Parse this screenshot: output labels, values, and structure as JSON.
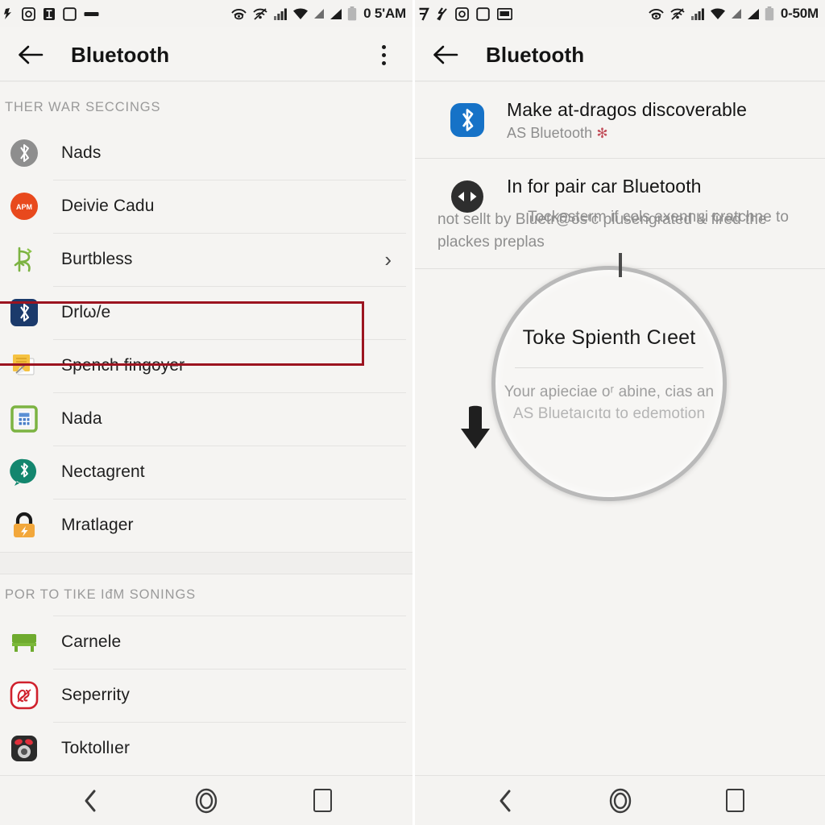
{
  "left_panel": {
    "status_bar": {
      "time": "0 5'AM",
      "left_icons": [
        "notification-icon",
        "screenshot-icon",
        "text-cursor-icon",
        "square-icon",
        "dash-icon"
      ],
      "right_icons": [
        "eye-wifi-icon",
        "cast-icon",
        "signal-bars-icon",
        "wifi-icon",
        "signal-triangle-icon",
        "signal-triangle-2-icon",
        "battery-icon"
      ]
    },
    "action_bar": {
      "title": "Bluetooth",
      "back_icon": "back-arrow-icon",
      "overflow_icon": "overflow-menu-icon"
    },
    "section_one": {
      "header": "THER WAR SECCINGS",
      "items": [
        {
          "label": "Nads",
          "icon": "bluetooth-gray-circle-icon"
        },
        {
          "label": "Deivie Cadu",
          "icon": "orange-circle-icon"
        },
        {
          "label": "Burtbless",
          "icon": "green-glyph-icon",
          "chevron": "›",
          "highlighted": true
        },
        {
          "label": "Drlω/e",
          "icon": "bluetooth-blue-square-icon"
        },
        {
          "label": "Spench fingoyer",
          "icon": "note-pen-icon"
        },
        {
          "label": "Nada",
          "icon": "calculator-green-icon"
        },
        {
          "label": "Nectagrent",
          "icon": "bluetooth-teal-chat-icon"
        },
        {
          "label": "Mratlager",
          "icon": "lock-bolt-icon"
        }
      ]
    },
    "section_two": {
      "header": "POR TO TIKE IđM SONINGS",
      "items": [
        {
          "label": "Carnele",
          "icon": "green-bench-icon"
        },
        {
          "label": "Seperrity",
          "icon": "red-badge-icon"
        },
        {
          "label": "Toktollıer",
          "icon": "dark-camera-icon"
        }
      ]
    },
    "nav_bar": {
      "back": "nav-back-icon",
      "home": "nav-home-icon",
      "recents": "nav-recents-icon"
    }
  },
  "right_panel": {
    "status_bar": {
      "time": "0-50M",
      "left_icons": [
        "seven-glyph-icon",
        "mute-icon",
        "screenshot-icon",
        "square-icon",
        "card-icon"
      ],
      "right_icons": [
        "eye-wifi-icon",
        "cast-icon",
        "signal-bars-icon",
        "wifi-icon",
        "signal-triangle-icon",
        "signal-triangle-2-icon",
        "battery-icon"
      ]
    },
    "action_bar": {
      "title": "Bluetooth",
      "back_icon": "back-arrow-icon"
    },
    "discoverable": {
      "title": "Make at-dragos discoverable",
      "subtitle": "AS Bluetooth",
      "star": "✻",
      "icon": "bluetooth-blue-rounded-icon"
    },
    "pair": {
      "title": "In for pair car Bluetooth",
      "icon": "pair-arrows-dark-icon",
      "paragraph_line1": "Tockesterm if cols axennui cratchne to",
      "paragraph_line2": "not sellt by Bluetr@osʳc plusengrated & fired the",
      "paragraph_line3": "plackes preplas"
    },
    "magnified": {
      "title": "Toke Spienth Cıeet",
      "sub_line1": "Your apieciae oʳ abine, cias an",
      "sub_line2": "AS Bluetaıcıtɑ to edemotion",
      "download_icon": "download-arrow-icon"
    },
    "nav_bar": {
      "back": "nav-back-icon",
      "home": "nav-home-icon",
      "recents": "nav-recents-icon"
    }
  },
  "colors": {
    "highlight_border": "#9c1420",
    "bluetooth_blue": "#1672c7",
    "panel_bg": "#f5f4f2",
    "divider": "#e4e3e1",
    "muted_text": "#8e8e8e"
  }
}
